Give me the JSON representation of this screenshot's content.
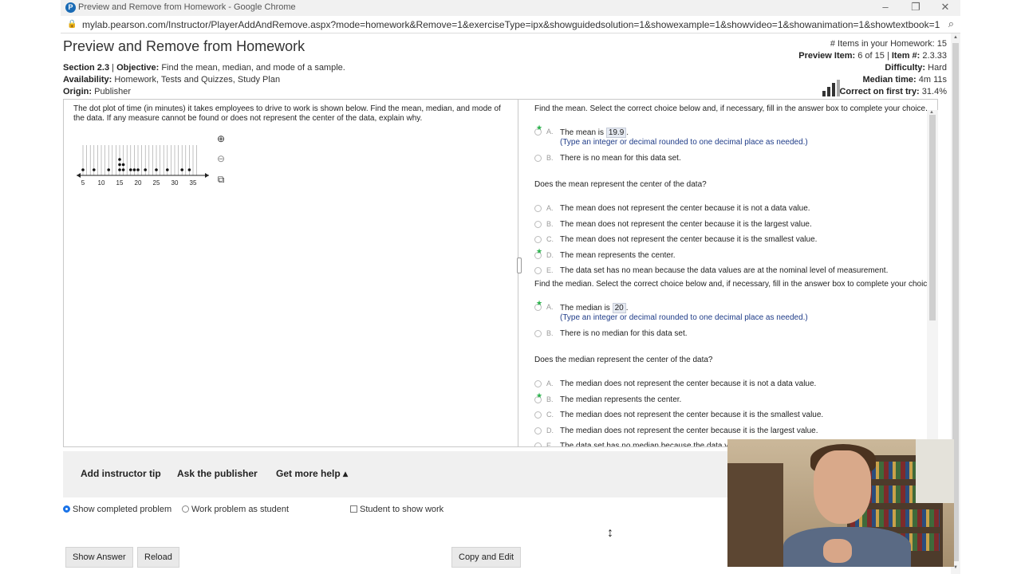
{
  "browser": {
    "tab_title": "Preview and Remove from Homework - Google Chrome",
    "url": "mylab.pearson.com/Instructor/PlayerAddAndRemove.aspx?mode=homework&Remove=1&exerciseType=ipx&showguidedsolution=1&showexample=1&showvideo=1&showanimation=1&showtextbook=1&s..."
  },
  "header": {
    "title": "Preview and Remove from Homework",
    "section_label": "Section 2.3",
    "objective_label": "Objective:",
    "objective_value": "Find the mean, median, and mode of a sample.",
    "availability_label": "Availability:",
    "availability_value": "Homework, Tests and Quizzes, Study Plan",
    "origin_label": "Origin:",
    "origin_value": "Publisher",
    "items_in_homework": "# Items in your Homework: 15",
    "preview_item_label": "Preview Item:",
    "preview_item_value": "6 of 15",
    "item_num_label": "Item #:",
    "item_num_value": "2.3.33",
    "difficulty_label": "Difficulty:",
    "difficulty_value": "Hard",
    "median_time_label": "Median time:",
    "median_time_value": "4m 11s",
    "correct_first_label": "Correct on first try:",
    "correct_first_value": "31.4%"
  },
  "question": {
    "text": "The dot plot of time (in minutes) it takes employees to drive to work is shown below. Find the mean, median, and mode of the data. If any measure cannot be found or does not represent the center of the data, explain why.",
    "axis_ticks": [
      "5",
      "10",
      "15",
      "20",
      "25",
      "30",
      "35"
    ],
    "dot_values": [
      5,
      8,
      12,
      15,
      15,
      15,
      16,
      16,
      18,
      19,
      20,
      22,
      25,
      28,
      32,
      34
    ]
  },
  "answers": {
    "mean_prompt": "Find the mean. Select the correct choice below and, if necessary, fill in the answer box to complete your choice.",
    "mean_a_text": "The mean is",
    "mean_a_value": "19.9",
    "mean_hint": "(Type an integer or decimal rounded to one decimal place as needed.)",
    "mean_b_text": "There is no mean for this data set.",
    "mean_center_prompt": "Does the mean represent the center of the data?",
    "mean_center_options": [
      "The mean does not represent the center because it is not a data value.",
      "The mean does not represent the center because it is the largest value.",
      "The mean does not represent the center because it is the smallest value.",
      "The mean represents the center.",
      "The data set has no mean because the data values are at the nominal level of measurement."
    ],
    "median_prompt": "Find the median. Select the correct choice below and, if necessary, fill in the answer box to complete your choice.",
    "median_a_text": "The median is",
    "median_a_value": "20",
    "median_hint": "(Type an integer or decimal rounded to one decimal place as needed.)",
    "median_b_text": "There is no median for this data set.",
    "median_center_prompt": "Does the median represent the center of the data?",
    "median_center_options": [
      "The median does not represent the center because it is not a data value.",
      "The median represents the center.",
      "The median does not represent the center because it is the smallest value.",
      "The median does not represent the center because it is the largest value.",
      "The data set has no median because the data va"
    ],
    "letters": [
      "A.",
      "B.",
      "C.",
      "D.",
      "E."
    ]
  },
  "toolbar": {
    "add_tip": "Add instructor tip",
    "ask_publisher": "Ask the publisher",
    "more_help": "Get more help ▴",
    "show_completed": "Show completed problem",
    "work_as_student": "Work problem as student",
    "student_show_work": "Student to show work",
    "show_answer": "Show Answer",
    "reload": "Reload",
    "copy_edit": "Copy and Edit"
  },
  "colors": {
    "correct_star": "#2bb24c",
    "hint_text": "#1f3c88",
    "selected_radio": "#1a73e8"
  }
}
